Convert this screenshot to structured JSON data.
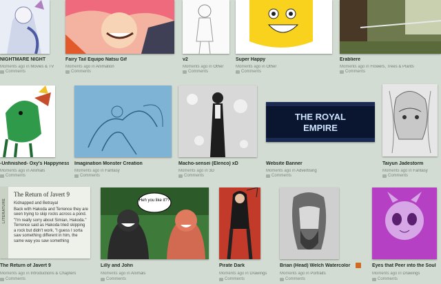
{
  "comments_label": "Comments",
  "cards": [
    {
      "title": "NIGHTMARE NIGHT",
      "meta_prefix": "Moments ago in",
      "category": "Movies & TV"
    },
    {
      "title": "Fairy Tail Equipo Natsu Gif",
      "meta_prefix": "Moments ago in",
      "category": "Animation"
    },
    {
      "title": "v2",
      "meta_prefix": "Moments ago in",
      "category": "Other"
    },
    {
      "title": "Super Happy",
      "meta_prefix": "Moments ago in",
      "category": "Other"
    },
    {
      "title": "Erabliere",
      "meta_prefix": "Moments ago in",
      "category": "Flowers, Trees & Plants"
    },
    {
      "title": "-Unfinished- Oxy's Happyness",
      "meta_prefix": "Moments ago in",
      "category": "Animals"
    },
    {
      "title": "Imagination Monster Creation",
      "meta_prefix": "Moments ago in",
      "category": "Fantasy"
    },
    {
      "title": "Macho-sensei (Elenco) xD",
      "meta_prefix": "Moments ago in",
      "category": "3D"
    },
    {
      "title": "Website Banner",
      "meta_prefix": "Moments ago in",
      "category": "Advertising"
    },
    {
      "title": "Taiyun Jadestorm",
      "meta_prefix": "Moments ago in",
      "category": "Fantasy"
    },
    {
      "title": "The Return of Javert 9",
      "meta_prefix": "Moments ago in",
      "category": "Introductions & Chapters"
    },
    {
      "title": "Lilly and John",
      "meta_prefix": "Moments ago in",
      "category": "Animals"
    },
    {
      "title": "Pirate Dark",
      "meta_prefix": "Moments ago in",
      "category": "Drawings"
    },
    {
      "title": "Brian (Head) Welch Watercolor",
      "meta_prefix": "Moments ago in",
      "category": "Portraits"
    },
    {
      "title": "Eyes that Peer into the Soul",
      "meta_prefix": "Moments ago in",
      "category": "Drawings"
    }
  ],
  "literature": {
    "band_label": "LITERATURE",
    "title": "The Return of Javert 9",
    "lines": [
      "Kidnapped and Betrayal",
      "Back with Hakoda and Terrence they are seen trying to skip rocks across a pond.",
      "\"I'm really sorry about Simian, Hakoda.\" Terrence said as Hakoda tried skipping a rock but didn't work, \"I guess I sorta saw something different in him, the same way you saw something"
    ]
  },
  "thumb_texts": {
    "speech_bubble": "Heh you like it??",
    "banner_line1": "THE ROYAL",
    "banner_line2": "EMPIRE"
  },
  "colors": {
    "background": "#d3dcd3",
    "title": "#1d2a1d",
    "meta": "#7a8a7a"
  }
}
